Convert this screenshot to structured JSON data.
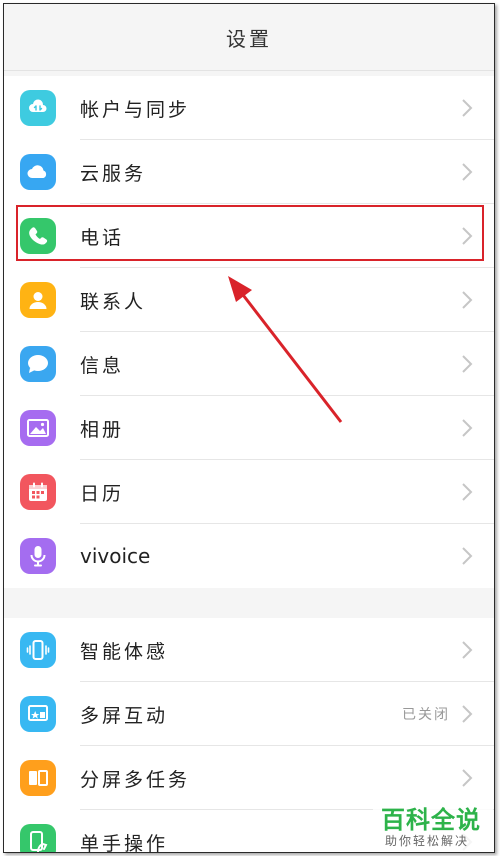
{
  "header": {
    "title": "设置"
  },
  "groups": [
    {
      "items": [
        {
          "label": "帐户与同步",
          "icon": "account-sync-icon",
          "color": "#3ecbe0"
        },
        {
          "label": "云服务",
          "icon": "cloud-icon",
          "color": "#37a7f2"
        },
        {
          "label": "电话",
          "icon": "phone-icon",
          "color": "#35c76b"
        },
        {
          "label": "联系人",
          "icon": "contact-icon",
          "color": "#ffb313"
        },
        {
          "label": "信息",
          "icon": "message-icon",
          "color": "#3aa7f0"
        },
        {
          "label": "相册",
          "icon": "album-icon",
          "color": "#a66cf0"
        },
        {
          "label": "日历",
          "icon": "calendar-icon",
          "color": "#f2565e"
        },
        {
          "label": "vivoice",
          "icon": "microphone-icon",
          "color": "#a46df0"
        }
      ]
    },
    {
      "items": [
        {
          "label": "智能体感",
          "icon": "smart-motion-icon",
          "color": "#38b8f2"
        },
        {
          "label": "多屏互动",
          "icon": "multiscreen-icon",
          "color": "#38b8f2",
          "status": "已关闭"
        },
        {
          "label": "分屏多任务",
          "icon": "split-screen-icon",
          "color": "#ff9f1c"
        },
        {
          "label": "单手操作",
          "icon": "one-hand-icon",
          "color": "#35c76b"
        }
      ]
    }
  ],
  "annotation": {
    "highlight_color": "#d9232a"
  },
  "watermark": {
    "title": "百科全说",
    "subtitle": "助你轻松解决"
  }
}
